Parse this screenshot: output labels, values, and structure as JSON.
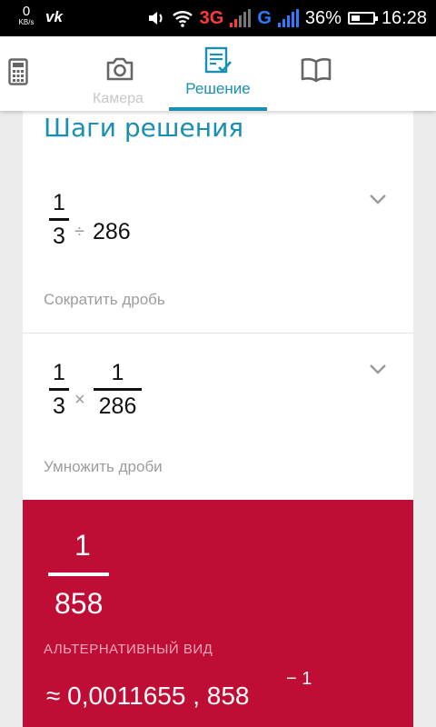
{
  "status_bar": {
    "speed_value": "0",
    "speed_unit": "KB/s",
    "vk_label": "vk",
    "network_3g": "3G",
    "network_g": "G",
    "battery_percent": "36%",
    "time": "16:28"
  },
  "tabs": [
    {
      "icon": "calculator-icon",
      "label": ""
    },
    {
      "icon": "camera-icon",
      "label": "Камера"
    },
    {
      "icon": "solution-icon",
      "label": "Решение",
      "active": true
    },
    {
      "icon": "book-icon",
      "label": ""
    }
  ],
  "solution": {
    "title": "Шаги решения",
    "steps": [
      {
        "numerator": "1",
        "denominator": "3",
        "operator": "÷",
        "operand": "286",
        "description": "Сократить дробь"
      },
      {
        "numerator": "1",
        "denominator": "3",
        "operator": "×",
        "operand_numerator": "1",
        "operand_denominator": "286",
        "description": "Умножить дроби"
      }
    ],
    "result": {
      "numerator": "1",
      "denominator": "858",
      "alt_label": "АЛЬТЕРНАТИВНЫЙ ВИД",
      "approx": "≈ 0,0011655 , 858",
      "exponent": "− 1"
    }
  },
  "colors": {
    "accent": "#1a8fb1",
    "result_bg": "#c00d36",
    "network_3g": "#ff3b3b",
    "network_g": "#2e7bff"
  }
}
